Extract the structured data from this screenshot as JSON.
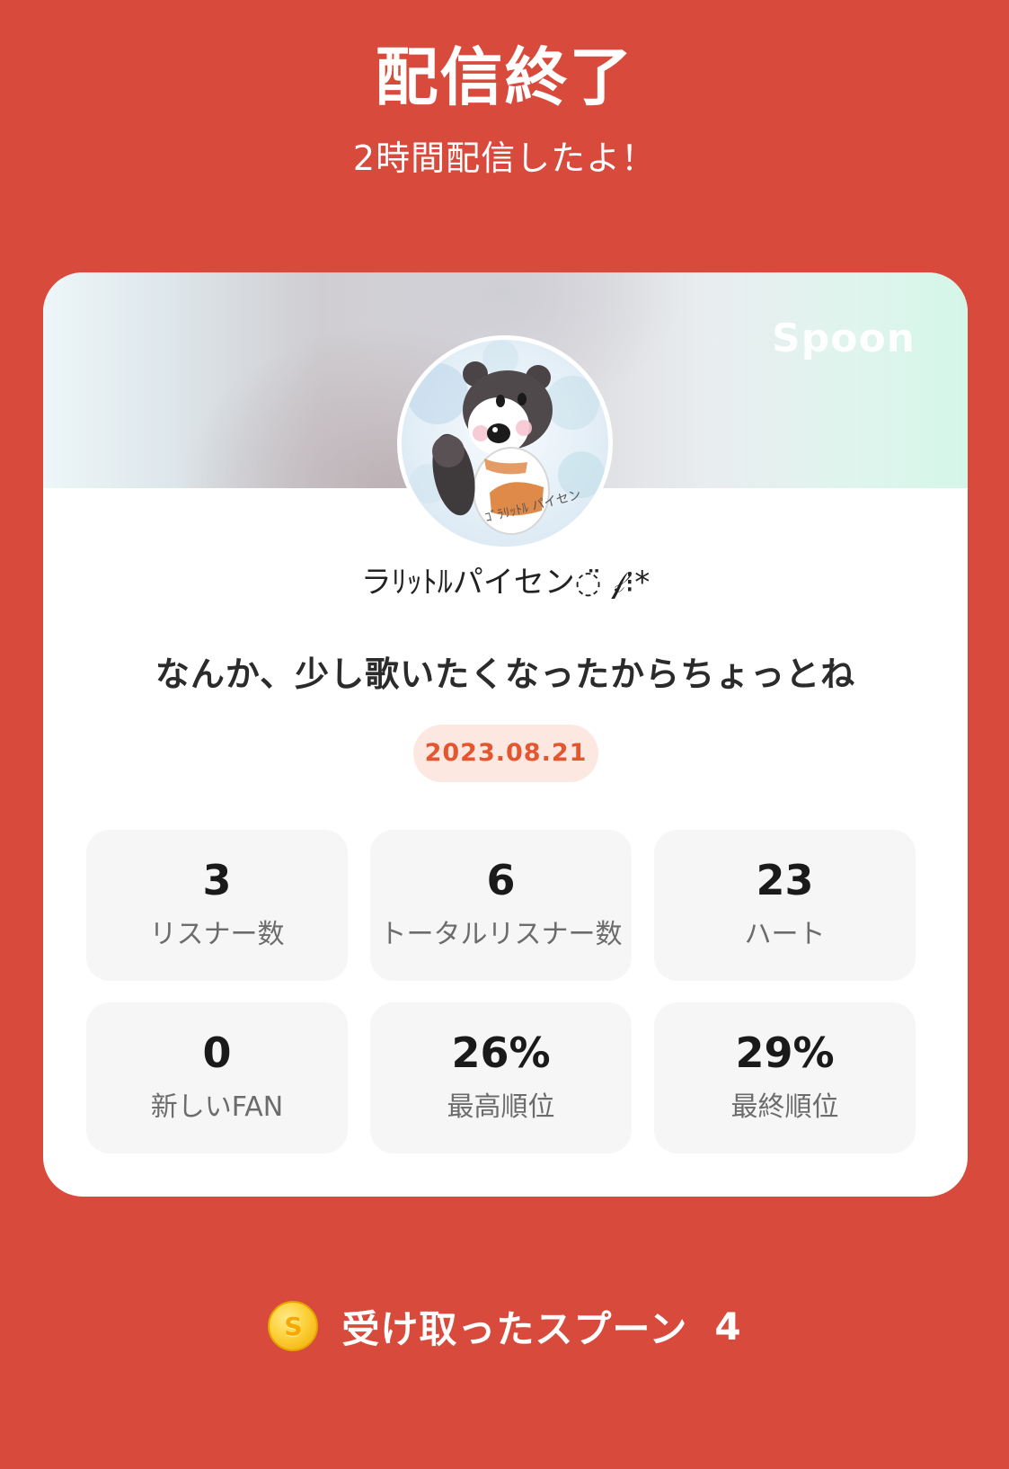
{
  "header": {
    "title": "配信終了",
    "subtitle": "2時間配信したよ！"
  },
  "card": {
    "brand": "Spoon",
    "avatar_icon": "bear-avatar-icon",
    "username": "ラﾘｯﾄﾙパイセン◌̈ 𝒻⁝*",
    "live_title": "なんか、少し歌いたくなったからちょっとね",
    "date": "2023.08.21",
    "stats": [
      {
        "value": "3",
        "label": "リスナー数"
      },
      {
        "value": "6",
        "label": "トータルリスナー数"
      },
      {
        "value": "23",
        "label": "ハート"
      },
      {
        "value": "0",
        "label": "新しいFAN"
      },
      {
        "value": "26%",
        "label": "最高順位"
      },
      {
        "value": "29%",
        "label": "最終順位"
      }
    ]
  },
  "spoons": {
    "icon": "spoon-coin-icon",
    "coin_letter": "S",
    "label": "受け取ったスプーン",
    "count": "4"
  },
  "colors": {
    "background": "#d84a3b",
    "card": "#ffffff",
    "date_text": "#e3562f",
    "date_badge": "#fde7e1",
    "stat_box": "#f6f6f6"
  }
}
